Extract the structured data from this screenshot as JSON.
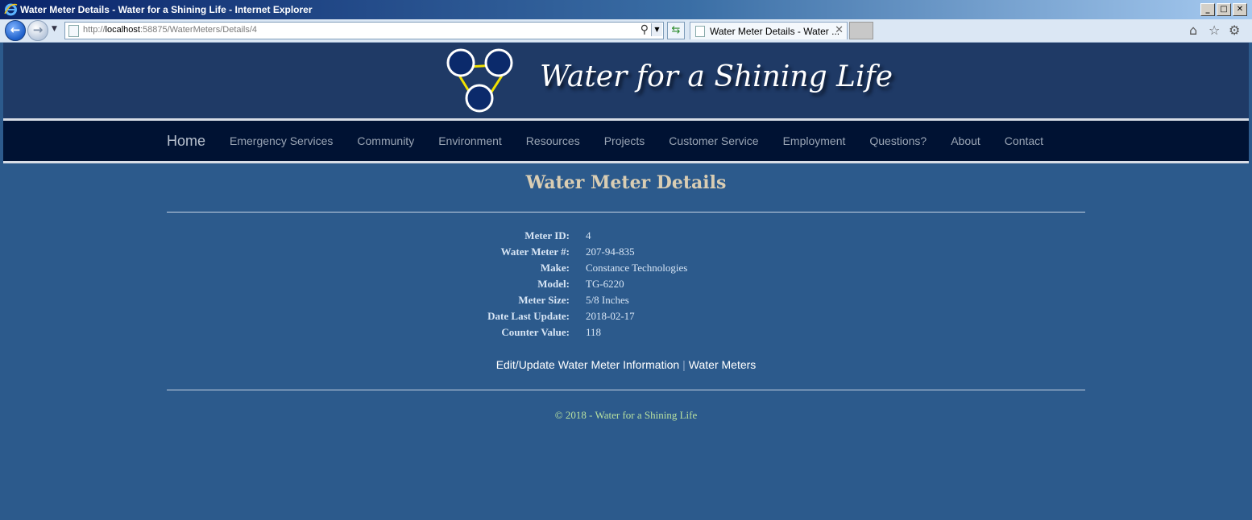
{
  "window": {
    "title": "Water Meter Details - Water for a Shining Life - Internet Explorer"
  },
  "toolbar": {
    "url_prefix": "http://",
    "url_host": "localhost",
    "url_rest": ":58875/WaterMeters/Details/4",
    "tab_label": "Water Meter Details - Water ...",
    "icons": [
      "back-icon",
      "forward-icon",
      "search-icon",
      "refresh-icon",
      "home-icon",
      "favorites-star-icon",
      "tools-gear-icon"
    ]
  },
  "site": {
    "title": "Water for a Shining Life",
    "logo_colors": {
      "circle": "#0b2a6b",
      "outline": "#ffffff",
      "triangle": "#f0e000"
    }
  },
  "nav": {
    "items": [
      "Home",
      "Emergency Services",
      "Community",
      "Environment",
      "Resources",
      "Projects",
      "Customer Service",
      "Employment",
      "Questions?",
      "About",
      "Contact"
    ]
  },
  "page": {
    "heading": "Water Meter Details",
    "fields": [
      {
        "label": "Meter ID:",
        "value": "4"
      },
      {
        "label": "Water Meter #:",
        "value": "207-94-835"
      },
      {
        "label": "Make:",
        "value": "Constance Technologies"
      },
      {
        "label": "Model:",
        "value": "TG-6220"
      },
      {
        "label": "Meter Size:",
        "value": "5/8 Inches"
      },
      {
        "label": "Date Last Update:",
        "value": "2018-02-17"
      },
      {
        "label": "Counter Value:",
        "value": "118"
      }
    ],
    "edit_link": "Edit/Update Water Meter Information",
    "separator": "|",
    "list_link": "Water Meters"
  },
  "footer": {
    "text": "© 2018 - Water for a Shining Life"
  },
  "colors": {
    "banner": "#1f3a66",
    "navbar": "#001233",
    "body": "#2c5a8c",
    "heading": "#d9cdb3",
    "footer": "#b8e0a0"
  }
}
